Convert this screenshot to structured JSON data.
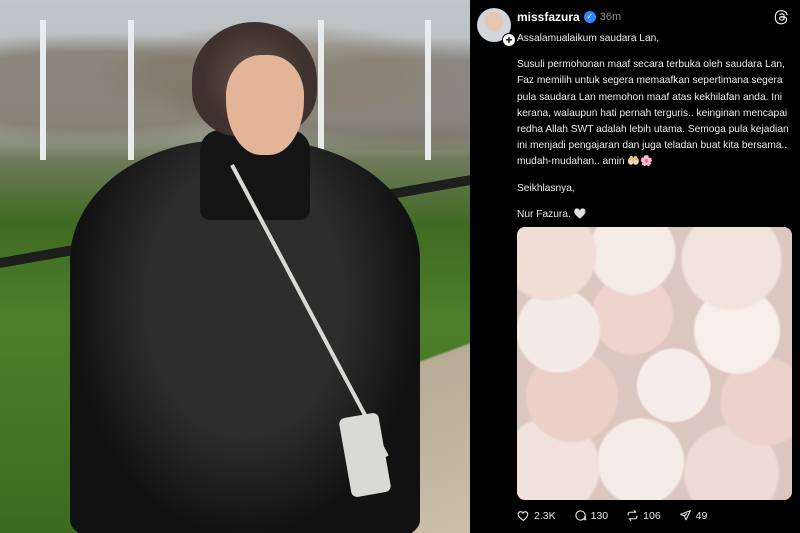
{
  "post": {
    "username": "missfazura",
    "time": "36m",
    "paragraphs": [
      "Assalamualaikum saudara Lan,",
      "Susuli permohonan maaf secara terbuka oleh saudara Lan, Faz memilih untuk segera memaafkan sepertimana segera pula saudara Lan memohon maaf atas kekhilafan anda. Ini kerana, walaupun hati pernah terguris.. keinginan mencapai redha Allah SWT adalah lebih utama. Semoga pula kejadian ini menjadi pengajaran dan juga teladan buat kita bersama.. mudah-mudahan.. amin 🤲🏻🌸",
      "Seikhlasnya,",
      "Nur Fazura. 🤍"
    ],
    "stats": {
      "likes": "2.3K",
      "comments": "130",
      "reposts": "106",
      "shares": "49"
    }
  },
  "icons": {
    "verified": "verified-badge-icon",
    "threads": "threads-logo-icon",
    "like": "heart-icon",
    "comment": "comment-icon",
    "repost": "repost-icon",
    "share": "share-icon"
  },
  "colors": {
    "background": "#000000",
    "text": "#ededed",
    "muted": "#8a8a8a",
    "verified": "#2d88ff"
  }
}
